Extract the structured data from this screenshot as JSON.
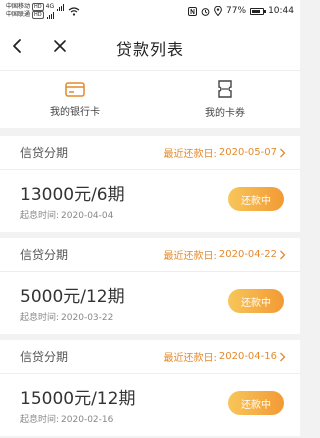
{
  "status_bar": {
    "carrier1": "中国移动",
    "carrier2": "中国联通",
    "hd": "HD",
    "network": "4G",
    "battery": "77%",
    "battery_level": 0.77,
    "time": "10:44"
  },
  "nav": {
    "title": "贷款列表",
    "back_icon": "chevron-left-icon",
    "close_icon": "close-icon"
  },
  "entries": [
    {
      "label": "我的银行卡",
      "icon": "bank-card-icon"
    },
    {
      "label": "我的卡券",
      "icon": "coupon-icon"
    }
  ],
  "colors": {
    "accent": "#e38a2e",
    "button_gradient_start": "#f7c65a",
    "button_gradient_end": "#f39a35"
  },
  "loans": [
    {
      "type": "信贷分期",
      "due_label": "最近还款日:",
      "due_date": "2020-05-07",
      "amount": "13000元/6期",
      "start_label": "起息时间:",
      "start_date": "2020-04-04",
      "status": "还款中"
    },
    {
      "type": "信贷分期",
      "due_label": "最近还款日:",
      "due_date": "2020-04-22",
      "amount": "5000元/12期",
      "start_label": "起息时间:",
      "start_date": "2020-03-22",
      "status": "还款中"
    },
    {
      "type": "信贷分期",
      "due_label": "最近还款日:",
      "due_date": "2020-04-16",
      "amount": "15000元/12期",
      "start_label": "起息时间:",
      "start_date": "2020-02-16",
      "status": "还款中"
    }
  ]
}
